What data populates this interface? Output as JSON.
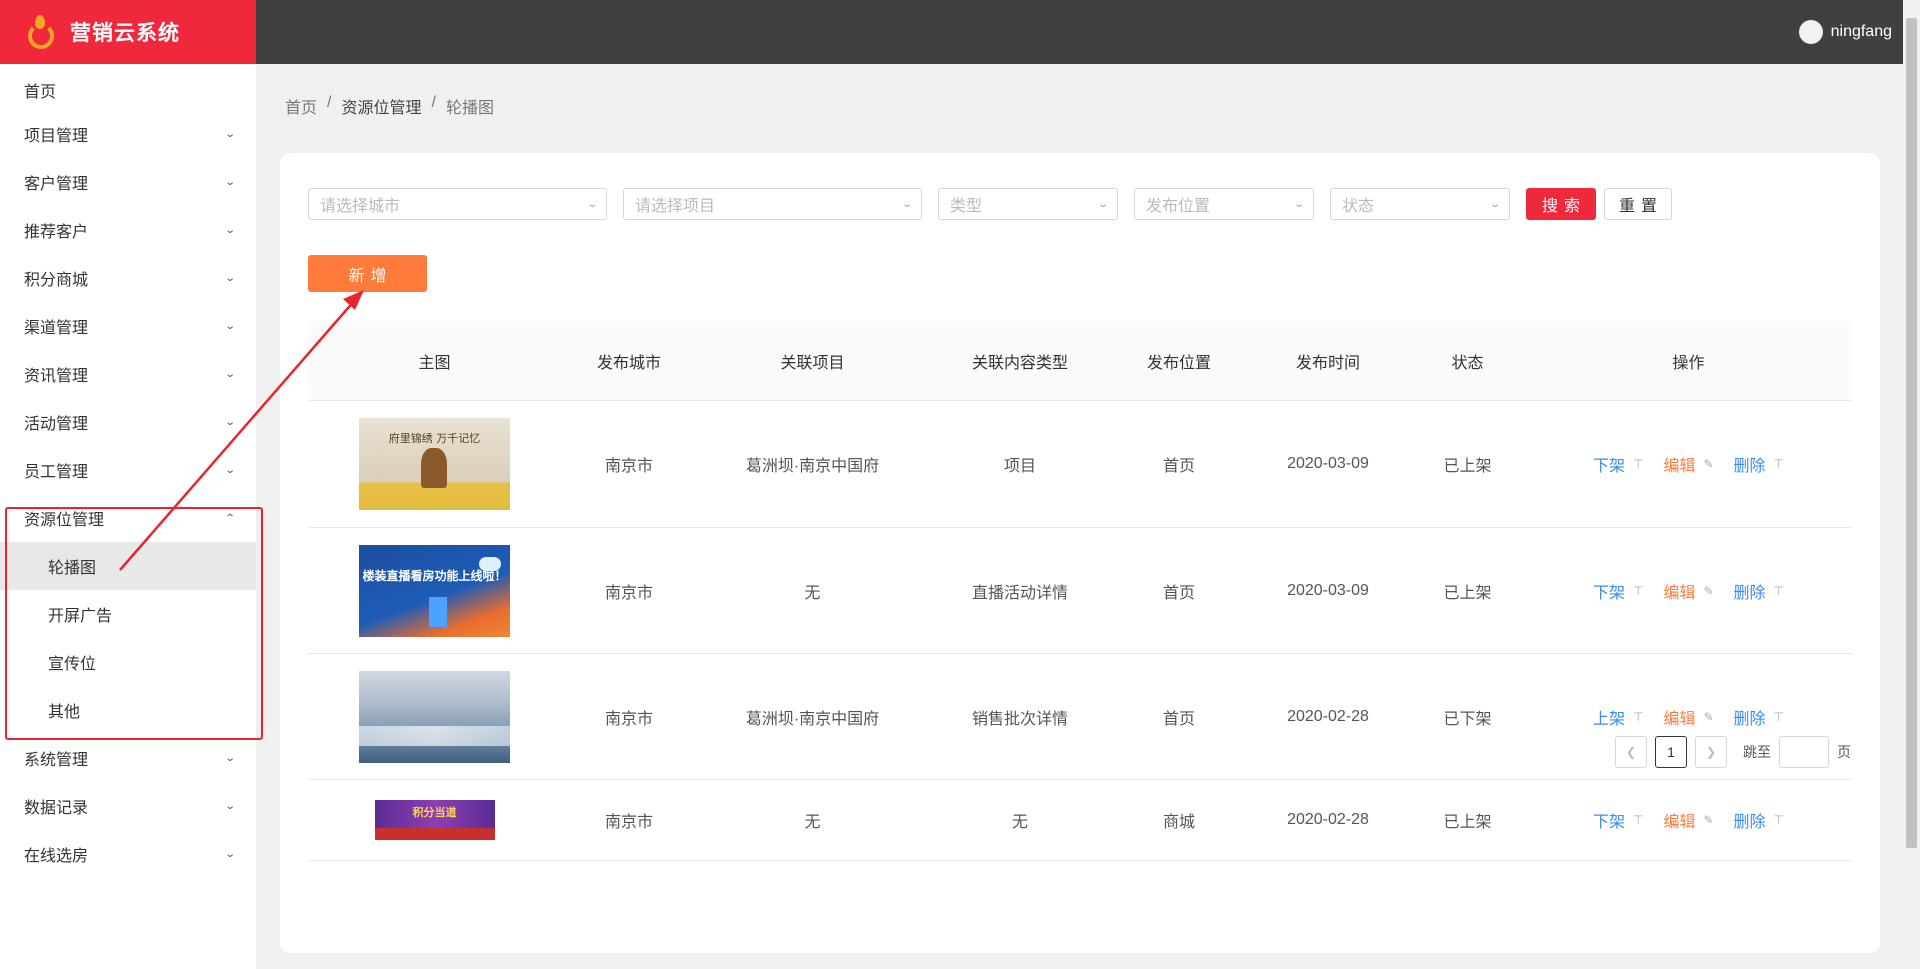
{
  "app": {
    "title": "营销云系统"
  },
  "user": {
    "name": "ningfang"
  },
  "sidebar": {
    "items": [
      {
        "label": "首页"
      },
      {
        "label": "项目管理"
      },
      {
        "label": "客户管理"
      },
      {
        "label": "推荐客户"
      },
      {
        "label": "积分商城"
      },
      {
        "label": "渠道管理"
      },
      {
        "label": "资讯管理"
      },
      {
        "label": "活动管理"
      },
      {
        "label": "员工管理"
      },
      {
        "label": "资源位管理"
      },
      {
        "label": "系统管理"
      },
      {
        "label": "数据记录"
      },
      {
        "label": "在线选房"
      }
    ],
    "sub_items": [
      {
        "label": "轮播图"
      },
      {
        "label": "开屏广告"
      },
      {
        "label": "宣传位"
      },
      {
        "label": "其他"
      }
    ]
  },
  "breadcrumb": [
    "首页",
    "资源位管理",
    "轮播图"
  ],
  "filters": {
    "city_placeholder": "请选择城市",
    "project_placeholder": "请选择项目",
    "type_placeholder": "类型",
    "position_placeholder": "发布位置",
    "status_placeholder": "状态",
    "search_label": "搜索",
    "reset_label": "重置",
    "add_label": "新增"
  },
  "table": {
    "columns": [
      "主图",
      "发布城市",
      "关联项目",
      "关联内容类型",
      "发布位置",
      "发布时间",
      "状态",
      "操作"
    ],
    "rows": [
      {
        "image_caption": "府里锦绣 万千记忆",
        "city": "南京市",
        "project": "葛洲坝·南京中国府",
        "content_type": "项目",
        "position": "首页",
        "time": "2020-03-09",
        "status": "已上架",
        "toggle": "下架",
        "edit": "编辑",
        "delete": "删除"
      },
      {
        "image_caption": "楼装直播看房功能上线啦！",
        "city": "南京市",
        "project": "无",
        "content_type": "直播活动详情",
        "position": "首页",
        "time": "2020-03-09",
        "status": "已上架",
        "toggle": "下架",
        "edit": "编辑",
        "delete": "删除"
      },
      {
        "image_caption": "",
        "city": "南京市",
        "project": "葛洲坝·南京中国府",
        "content_type": "销售批次详情",
        "position": "首页",
        "time": "2020-02-28",
        "status": "已下架",
        "toggle": "上架",
        "edit": "编辑",
        "delete": "删除"
      },
      {
        "image_caption": "积分当道",
        "city": "南京市",
        "project": "无",
        "content_type": "无",
        "position": "商城",
        "time": "2020-02-28",
        "status": "已上架",
        "toggle": "下架",
        "edit": "编辑",
        "delete": "删除"
      }
    ]
  },
  "pagination": {
    "current": "1",
    "jump_label": "跳至",
    "page_suffix": "页"
  },
  "colors": {
    "brand": "#f0283c",
    "add": "#ff7b3c",
    "link": "#3b8cf0",
    "header": "#404040",
    "annotation": "#e8252c"
  }
}
